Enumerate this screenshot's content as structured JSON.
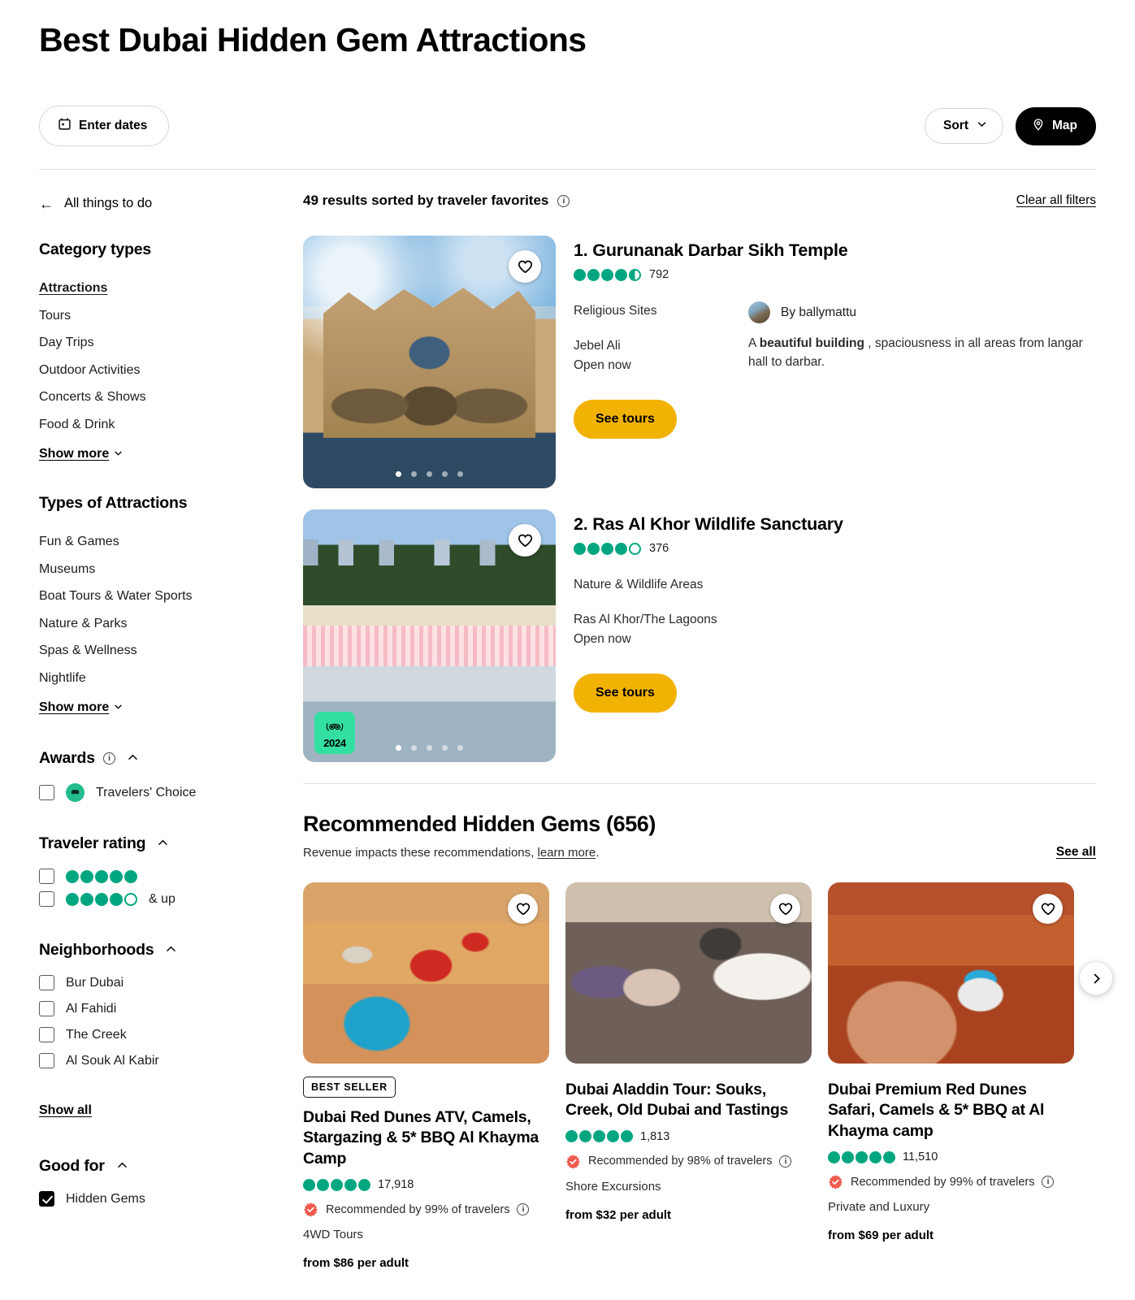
{
  "header": {
    "title": "Best Dubai Hidden Gem Attractions",
    "dates_button": "Enter dates",
    "sort_button": "Sort",
    "map_button": "Map"
  },
  "results_bar": {
    "back_label": "All things to do",
    "count_text": "49 results sorted by traveler favorites",
    "clear_filters": "Clear all filters"
  },
  "sidebar": {
    "category_types": {
      "title": "Category types",
      "items": [
        "Attractions",
        "Tours",
        "Day Trips",
        "Outdoor Activities",
        "Concerts & Shows",
        "Food & Drink"
      ],
      "active": "Attractions",
      "show_more": "Show more"
    },
    "types_of_attractions": {
      "title": "Types of Attractions",
      "items": [
        "Fun & Games",
        "Museums",
        "Boat Tours & Water Sports",
        "Nature & Parks",
        "Spas & Wellness",
        "Nightlife"
      ],
      "show_more": "Show more"
    },
    "awards": {
      "title": "Awards",
      "items": [
        {
          "label": "Travelers' Choice",
          "checked": false
        }
      ]
    },
    "traveler_rating": {
      "title": "Traveler rating",
      "rows": [
        {
          "bubbles": 5,
          "suffix": ""
        },
        {
          "bubbles": 4,
          "suffix": "& up"
        }
      ]
    },
    "neighborhoods": {
      "title": "Neighborhoods",
      "items": [
        {
          "label": "Bur Dubai",
          "checked": false
        },
        {
          "label": "Al Fahidi",
          "checked": false
        },
        {
          "label": "The Creek",
          "checked": false
        },
        {
          "label": "Al Souk Al Kabir",
          "checked": false
        }
      ],
      "show_all": "Show all"
    },
    "good_for": {
      "title": "Good for",
      "items": [
        {
          "label": "Hidden Gems",
          "checked": true
        }
      ]
    }
  },
  "attractions": [
    {
      "name": "1. Gurunanak Darbar Sikh Temple",
      "rating": 4.5,
      "reviews": "792",
      "category": "Religious Sites",
      "neighborhood": "Jebel Ali",
      "status": "Open now",
      "cta": "See tours",
      "reviewer": "By ballymattu",
      "quote_pre": "A ",
      "quote_bold": "beautiful building",
      "quote_post": " , spaciousness in all areas from langar hall to darbar.",
      "photo": "temple",
      "dots": 5,
      "active_dot": 0,
      "award_badge": null
    },
    {
      "name": "2. Ras Al Khor Wildlife Sanctuary",
      "rating": 4.0,
      "reviews": "376",
      "category": "Nature & Wildlife Areas",
      "neighborhood": "Ras Al Khor/The Lagoons",
      "status": "Open now",
      "cta": "See tours",
      "reviewer": null,
      "quote_pre": null,
      "quote_bold": null,
      "quote_post": null,
      "photo": "flamingo",
      "dots": 5,
      "active_dot": 0,
      "award_badge": "2024"
    }
  ],
  "recommended": {
    "title": "Recommended Hidden Gems (656)",
    "subtitle_pre": "Revenue impacts these recommendations, ",
    "subtitle_link": "learn more",
    "subtitle_post": ".",
    "see_all": "See all",
    "cards": [
      {
        "badge": "BEST SELLER",
        "name": "Dubai Red Dunes ATV, Camels, Stargazing & 5* BBQ Al Khayma Camp",
        "rating": 5.0,
        "reviews": "17,918",
        "recommended": "Recommended by 99% of travelers",
        "category": "4WD Tours",
        "price": "from $86 per adult",
        "photo": "atv"
      },
      {
        "badge": null,
        "name": "Dubai Aladdin Tour: Souks, Creek, Old Dubai and Tastings",
        "rating": 5.0,
        "reviews": "1,813",
        "recommended": "Recommended by 98% of travelers",
        "category": "Shore Excursions",
        "price": "from $32 per adult",
        "photo": "souk"
      },
      {
        "badge": null,
        "name": "Dubai Premium Red Dunes Safari, Camels & 5* BBQ at Al Khayma camp",
        "rating": 5.0,
        "reviews": "11,510",
        "recommended": "Recommended by 99% of travelers",
        "category": "Private and Luxury",
        "price": "from $69 per adult",
        "photo": "safari"
      }
    ]
  },
  "colors": {
    "bubble_green": "#00a680",
    "cta_yellow": "#f2b203",
    "badge_green": "#34e0a1",
    "rosette_red": "#ee5b50"
  }
}
